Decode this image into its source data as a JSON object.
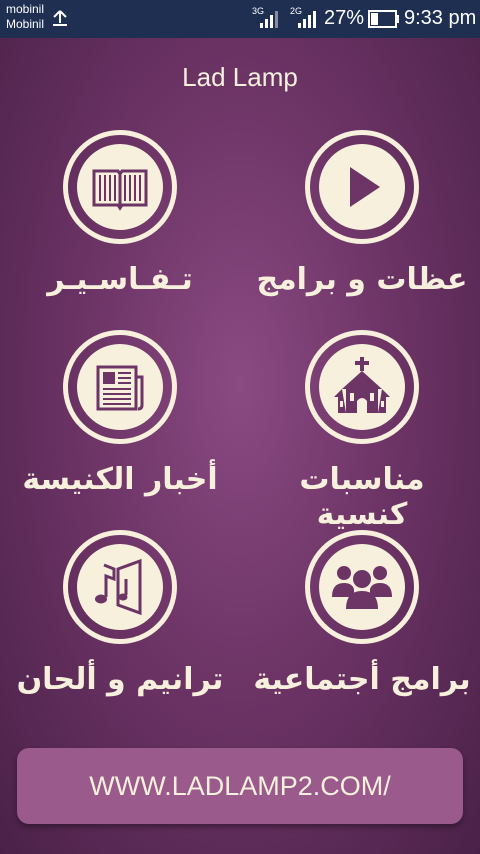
{
  "status_bar": {
    "carrier_line1": "mobinil",
    "carrier_line2": "Mobinil",
    "network1": "3G",
    "network2": "2G",
    "battery": "27%",
    "time": "9:33 pm"
  },
  "app": {
    "title": "Lad Lamp"
  },
  "menu": [
    {
      "label": "عظات و برامج",
      "icon": "play-icon"
    },
    {
      "label": "تـفـاسـيـر",
      "icon": "book-icon"
    },
    {
      "label": "مناسبات كنسية",
      "icon": "church-icon"
    },
    {
      "label": "أخبار الكنيسة",
      "icon": "newspaper-icon"
    },
    {
      "label": "برامج أجتماعية",
      "icon": "people-icon"
    },
    {
      "label": "ترانيم و ألحان",
      "icon": "music-icon"
    }
  ],
  "footer": {
    "url": "WWW.LADLAMP2.COM/"
  },
  "colors": {
    "background": "#6d3466",
    "icon_cream": "#f6f0dc",
    "button": "#9a5a8c",
    "status_bar": "#1e2f52"
  }
}
